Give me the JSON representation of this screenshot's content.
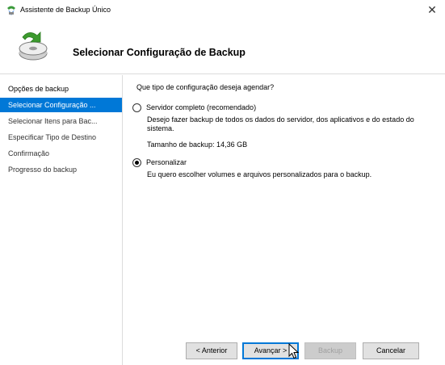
{
  "window": {
    "title": "Assistente de Backup Único",
    "close_glyph": "✕"
  },
  "header": {
    "title": "Selecionar Configuração de Backup",
    "icon": "backup-wizard-icon"
  },
  "sidebar": {
    "items": [
      {
        "label": "Opções de backup",
        "state": "normal"
      },
      {
        "label": "Selecionar Configuração ...",
        "state": "selected"
      },
      {
        "label": "Selecionar Itens para Bac...",
        "state": "normal"
      },
      {
        "label": "Especificar Tipo de Destino",
        "state": "normal"
      },
      {
        "label": "Confirmação",
        "state": "normal"
      },
      {
        "label": "Progresso do backup",
        "state": "normal"
      }
    ]
  },
  "main": {
    "question": "Que tipo de configuração deseja agendar?",
    "options": [
      {
        "label": "Servidor completo (recomendado)",
        "checked": false,
        "description": "Desejo fazer backup de todos os dados do servidor, dos aplicativos e do estado do sistema.",
        "extra": "Tamanho de backup: 14,36 GB"
      },
      {
        "label": "Personalizar",
        "checked": true,
        "description": "Eu quero escolher volumes e arquivos personalizados para o backup."
      }
    ]
  },
  "footer": {
    "back_label": "< Anterior",
    "next_label": "Avançar >",
    "backup_label": "Backup",
    "cancel_label": "Cancelar"
  },
  "colors": {
    "selection": "#0078d7",
    "button_face": "#e1e1e1",
    "disabled_text": "#a0a0a0"
  }
}
